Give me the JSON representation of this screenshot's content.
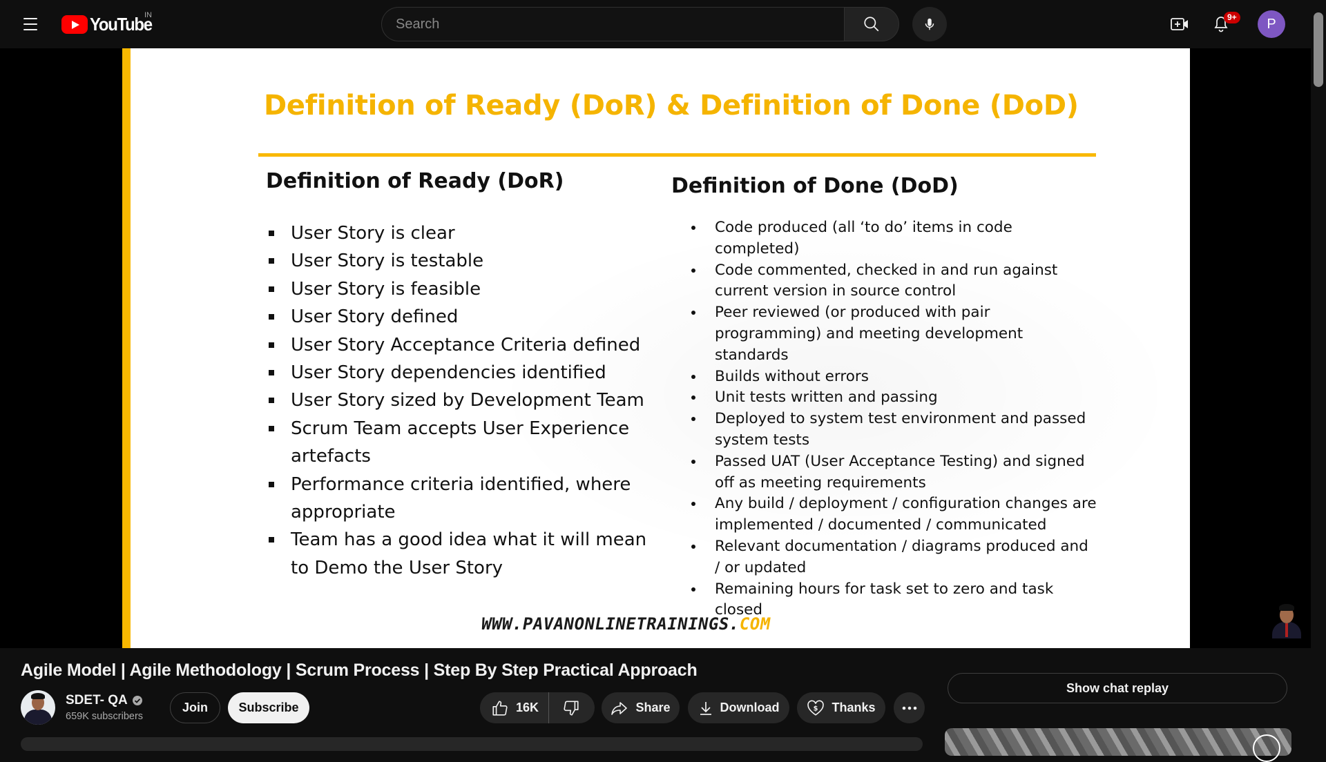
{
  "header": {
    "logo_text": "YouTube",
    "region": "IN",
    "search_placeholder": "Search",
    "notification_count": "9+",
    "avatar_initial": "P"
  },
  "slide": {
    "title": "Definition of Ready (DoR) & Definition of Done (DoD)",
    "left_heading": "Definition of Ready (DoR)",
    "left_items": [
      "User Story is clear",
      "User Story is testable",
      "User Story is feasible",
      "User Story defined",
      "User Story Acceptance Criteria defined",
      "User Story dependencies identified",
      "User Story sized by Development Team",
      "Scrum Team accepts User Experience artefacts",
      "Performance criteria identified, where appropriate",
      "Team has a good idea what it will mean to Demo the User Story"
    ],
    "right_heading": "Definition of Done (DoD)",
    "right_items": [
      "Code produced (all ‘to do’ items in code completed)",
      "Code commented, checked in and run against current version in source control",
      "Peer reviewed (or produced with pair programming) and meeting development standards",
      "Builds without errors",
      "Unit tests written and passing",
      "Deployed to system test environment and passed system tests",
      "Passed UAT (User Acceptance Testing) and signed off as meeting requirements",
      "Any build / deployment / configuration changes are implemented / documented / communicated",
      "Relevant documentation / diagrams produced and / or updated",
      "Remaining hours for task set to zero and task closed"
    ],
    "url_main": "WWW.PAVANONLINETRAININGS.",
    "url_tld": "COM"
  },
  "video": {
    "title": "Agile Model | Agile Methodology | Scrum Process | Step By Step Practical Approach"
  },
  "channel": {
    "name": "SDET- QA",
    "subscribers": "659K subscribers",
    "join_label": "Join",
    "subscribe_label": "Subscribe"
  },
  "actions": {
    "likes": "16K",
    "share_label": "Share",
    "download_label": "Download",
    "thanks_label": "Thanks"
  },
  "chat": {
    "replay_label": "Show chat replay"
  },
  "colors": {
    "accent_yellow": "#f9b800",
    "youtube_red": "#ff0000",
    "avatar_purple": "#7e57c2",
    "badge_red": "#cc0000"
  },
  "icons": [
    "menu-icon",
    "youtube-logo",
    "search-icon",
    "mic-icon",
    "create-icon",
    "bell-icon",
    "verified-icon",
    "like-icon",
    "dislike-icon",
    "share-icon",
    "download-icon",
    "thanks-icon",
    "more-icon"
  ]
}
